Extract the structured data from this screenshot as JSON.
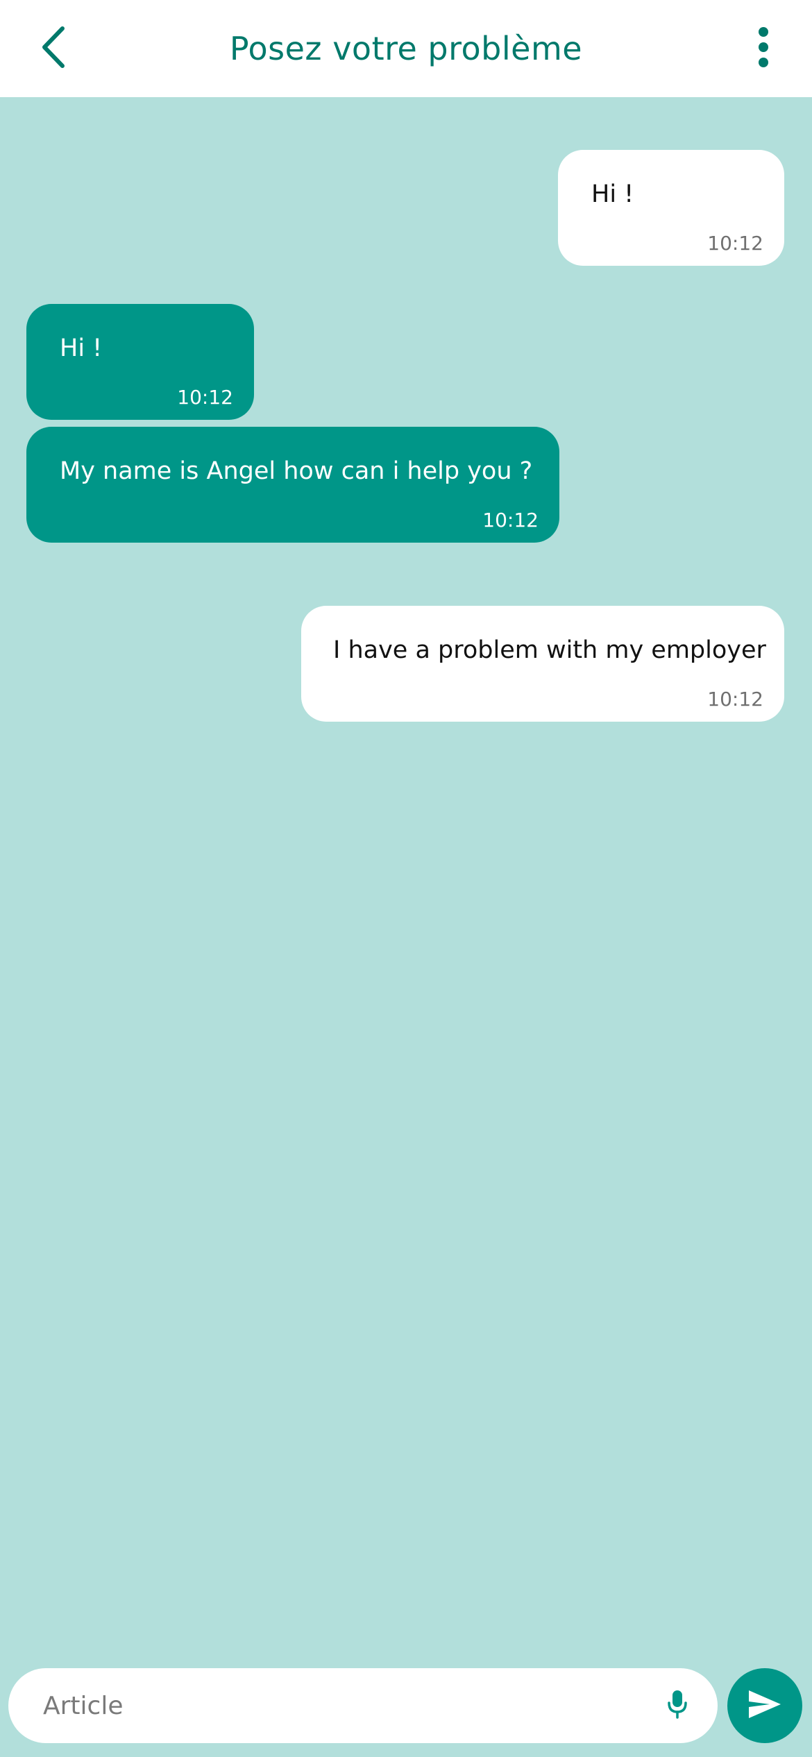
{
  "header": {
    "title": "Posez votre problème",
    "back_icon": "chevron-left-icon",
    "menu_icon": "more-vertical-icon"
  },
  "messages": [
    {
      "direction": "outgoing",
      "text": "Hi !",
      "time": "10:12"
    },
    {
      "direction": "incoming",
      "text": "Hi !",
      "time": "10:12"
    },
    {
      "direction": "incoming",
      "text": "My name is Angel how can i help you ?",
      "time": "10:12"
    },
    {
      "direction": "outgoing",
      "text": "I have a problem with my employer",
      "time": "10:12"
    }
  ],
  "composer": {
    "value": "",
    "placeholder": "Article",
    "mic_icon": "microphone-icon",
    "send_icon": "send-icon"
  },
  "colors": {
    "accent": "#009688",
    "title": "#00796b",
    "background": "#b2dfdb",
    "outgoing_bubble": "#ffffff"
  }
}
